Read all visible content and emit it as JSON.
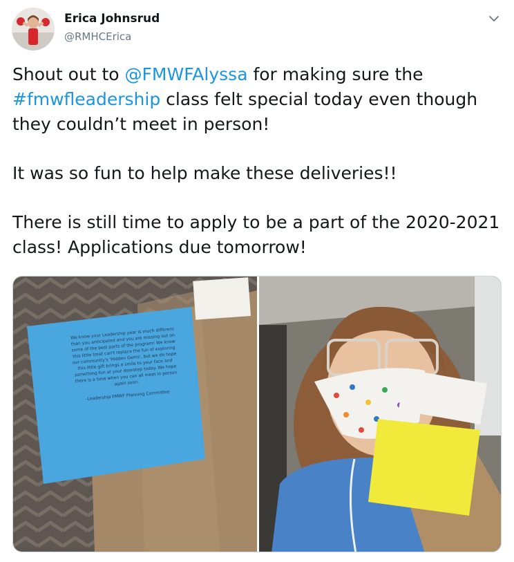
{
  "tweet": {
    "author_name": "Erica Johnsrud",
    "author_handle": "@RMHCErica",
    "paragraph1": {
      "text1": "Shout out to ",
      "mention": "@FMWFAlyssa",
      "text2": " for making sure the ",
      "hashtag": "#fmwfleadership",
      "text3": " class felt special today even though they couldn’t meet in person!"
    },
    "paragraph2": "It was so fun to help make these deliveries!!",
    "paragraph3": "There is still time to apply to be a part of the 2020-2021 class! Applications due tomorrow!"
  },
  "media": {
    "photo1_note": "We know your Leadership year is much different than you anticipated and you are missing out on some of the best parts of the program! We know this little treat can't replace the fun of exploring our community's 'Hidden Gems', but we do hope this little gift brings a smile to your face and something fun at your doorstep today. We hope there is a time when you can all meet in person again soon.",
    "photo1_signature": "-Leadership FMWF Planning Committee"
  },
  "icons": {
    "menu": "chevron-down-icon"
  },
  "colors": {
    "link": "#1b95e0",
    "text": "#14171a",
    "secondary": "#657786"
  }
}
